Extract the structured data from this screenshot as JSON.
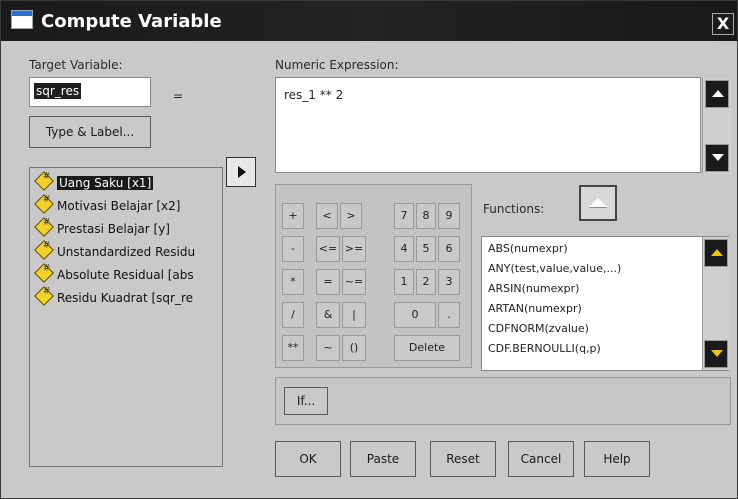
{
  "window": {
    "title": "Compute Variable",
    "close_label": "X"
  },
  "target": {
    "label": "Target Variable:",
    "value": "sqr_res",
    "equals": "=",
    "type_label_button": "Type & Label..."
  },
  "expression": {
    "label": "Numeric Expression:",
    "value": "res_1 ** 2"
  },
  "variables": [
    {
      "label": "Uang Saku [x1]",
      "selected": true
    },
    {
      "label": "Motivasi Belajar [x2]"
    },
    {
      "label": "Prestasi Belajar [y]"
    },
    {
      "label": "Unstandardized Residu"
    },
    {
      "label": "Absolute Residual [abs"
    },
    {
      "label": "Residu Kuadrat [sqr_re"
    }
  ],
  "keypad": {
    "row1": [
      "+",
      "<",
      ">",
      "7",
      "8",
      "9"
    ],
    "row2": [
      "-",
      "<=",
      ">=",
      "4",
      "5",
      "6"
    ],
    "row3": [
      "*",
      "=",
      "~=",
      "1",
      "2",
      "3"
    ],
    "row4": [
      "/",
      "&",
      "|",
      "0",
      "."
    ],
    "row5": [
      "**",
      "~",
      "()",
      "Delete"
    ]
  },
  "functions": {
    "label": "Functions:",
    "items": [
      "ABS(numexpr)",
      "ANY(test,value,value,...)",
      "ARSIN(numexpr)",
      "ARTAN(numexpr)",
      "CDFNORM(zvalue)",
      "CDF.BERNOULLI(q,p)"
    ]
  },
  "if_button": "If...",
  "buttons": {
    "ok": "OK",
    "paste": "Paste",
    "reset": "Reset",
    "cancel": "Cancel",
    "help": "Help"
  }
}
